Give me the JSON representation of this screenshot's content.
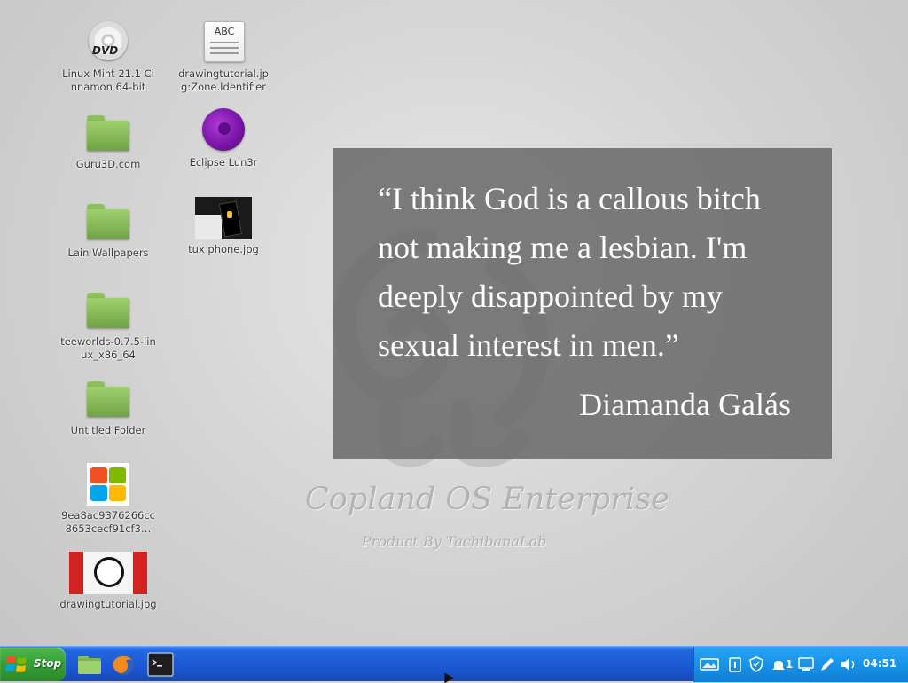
{
  "desktop": {
    "icons": [
      {
        "label": "Linux Mint 21.1 Cinnamon 64-bit",
        "icon": "dvd-icon"
      },
      {
        "label": "drawingtutorial.jpg:Zone.Identifier",
        "icon": "text-document-icon",
        "doc_text": "ABC"
      },
      {
        "label": "Guru3D.com",
        "icon": "folder-icon"
      },
      {
        "label": "Eclipse Lun3r",
        "icon": "purple-sphere-icon"
      },
      {
        "label": "Lain Wallpapers",
        "icon": "folder-icon"
      },
      {
        "label": "tux phone.jpg",
        "icon": "image-thumbnail-icon"
      },
      {
        "label": "teeworlds-0.7.5-linux_x86_64",
        "icon": "folder-icon"
      },
      {
        "label": "Untitled Folder",
        "icon": "folder-icon"
      },
      {
        "label": "9ea8ac9376266cc8653cecf91cf3…",
        "icon": "windows-logo-icon"
      },
      {
        "label": "drawingtutorial.jpg",
        "icon": "image-thumbnail-icon"
      }
    ],
    "dvd_text": "DVD"
  },
  "quote": {
    "text": "“I think God is a callous bitch not making me a lesbian. I'm deeply disappointed by my sexual interest in men.”",
    "author": "Diamanda Galás"
  },
  "wallpaper": {
    "title": "Copland OS Enterprise",
    "subtitle": "Product By TachibanaLab"
  },
  "taskbar": {
    "start_label": "Stop",
    "launchers": [
      "file-manager-icon",
      "firefox-icon",
      "terminal-icon"
    ],
    "tray": {
      "icons": [
        "network-icon",
        "clipboard-icon",
        "shield-icon",
        "notifications-icon",
        "display-icon",
        "pen-icon",
        "volume-icon"
      ],
      "notification_count": "1",
      "clock": "04:51"
    },
    "colors": {
      "bar": "#1b57d2",
      "start": "#37a137",
      "tray": "#1793e8"
    }
  }
}
